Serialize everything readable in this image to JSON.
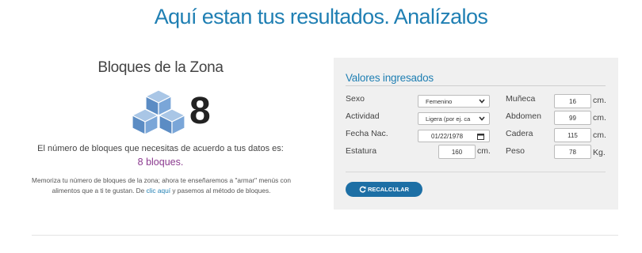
{
  "page": {
    "title": "Aquí estan tus resultados. Analízalos"
  },
  "zone": {
    "heading": "Bloques de la Zona",
    "count": "8",
    "icon": "cubes-icon",
    "need_text": "El número de bloques que necesitas de acuerdo a tus datos es:",
    "blocks_text": "8 bloques.",
    "memo_before": "Memoriza tu número de bloques de la zona; ahora te enseñaremos a \"armar\" menús con alimentos que a ti te gustan. De ",
    "memo_link": "clic aquí",
    "memo_after": " y pasemos al método de bloques."
  },
  "panel": {
    "title": "Valores ingresados",
    "sexo": {
      "label": "Sexo",
      "value": "Femenino"
    },
    "actividad": {
      "label": "Actividad",
      "value": "Ligera (por ej. ca"
    },
    "fecha": {
      "label": "Fecha Nac.",
      "value": "01/22/1978"
    },
    "estatura": {
      "label": "Estatura",
      "value": "160",
      "unit": "cm."
    },
    "muneca": {
      "label": "Muñeca",
      "value": "16",
      "unit": "cm."
    },
    "abdomen": {
      "label": "Abdomen",
      "value": "99",
      "unit": "cm."
    },
    "cadera": {
      "label": "Cadera",
      "value": "115",
      "unit": "cm."
    },
    "peso": {
      "label": "Peso",
      "value": "78",
      "unit": "Kg."
    },
    "button": "RECALCULAR"
  },
  "colors": {
    "accent": "#1f7fb3",
    "button": "#1d6fa5",
    "highlight": "#8b3a8f",
    "cube": "#6f9fce"
  }
}
